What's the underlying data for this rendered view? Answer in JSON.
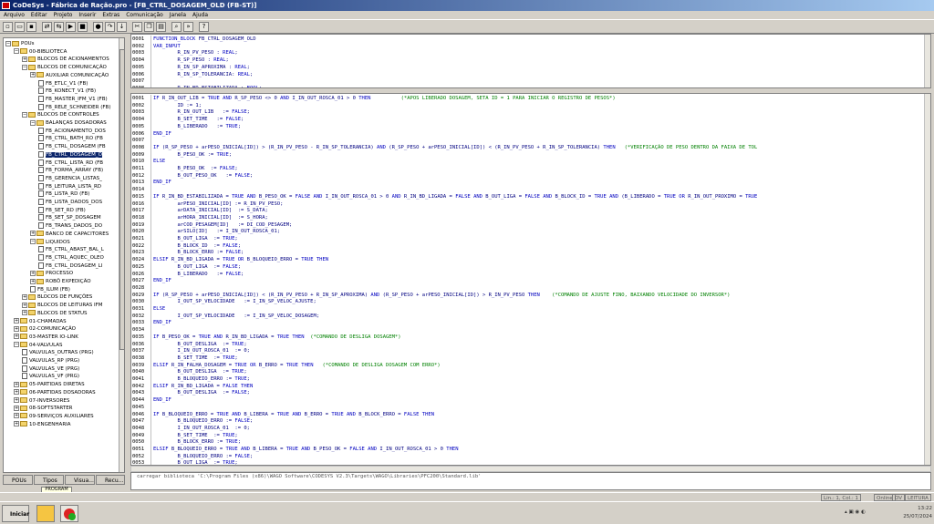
{
  "window": {
    "title": "CoDeSys - Fábrica de Ração.pro - [FB_CTRL_DOSAGEM_OLD (FB-ST)]"
  },
  "menu": [
    "Arquivo",
    "Editar",
    "Projeto",
    "Inserir",
    "Extras",
    "Comunicação",
    "Janela",
    "Ajuda"
  ],
  "tree": [
    {
      "label": "POUs",
      "level": 0,
      "type": "folder",
      "expanded": true
    },
    {
      "label": "00-BIBLIOTECA",
      "level": 1,
      "type": "folder",
      "expanded": true
    },
    {
      "label": "BLOCOS DE ACIONAMENTOS",
      "level": 2,
      "type": "folder",
      "expanded": false
    },
    {
      "label": "BLOCOS DE COMUNICAÇÃO",
      "level": 2,
      "type": "folder",
      "expanded": true
    },
    {
      "label": "AUXILIAR COMUNICAÇÃO",
      "level": 3,
      "type": "folder",
      "expanded": false
    },
    {
      "label": "FB_ETLC_V1 (FB)",
      "level": 4,
      "type": "doc"
    },
    {
      "label": "FB_KONECT_V1 (FB)",
      "level": 4,
      "type": "doc"
    },
    {
      "label": "FB_MASTER_IFM_V1 (FB)",
      "level": 4,
      "type": "doc"
    },
    {
      "label": "FB_RELE_SCHNEIDER (FB)",
      "level": 4,
      "type": "doc"
    },
    {
      "label": "BLOCOS DE CONTROLES",
      "level": 2,
      "type": "folder",
      "expanded": true
    },
    {
      "label": "BALANÇAS DOSADORAS",
      "level": 3,
      "type": "folder",
      "expanded": true
    },
    {
      "label": "FB_ACIONAMENTO_DOS",
      "level": 4,
      "type": "doc"
    },
    {
      "label": "FB_CTRL_BATH_RO (FB",
      "level": 4,
      "type": "doc"
    },
    {
      "label": "FB_CTRL_DOSAGEM (FB",
      "level": 4,
      "type": "doc"
    },
    {
      "label": "FB_CTRL_DOSAGEM_O",
      "level": 4,
      "type": "doc",
      "selected": true
    },
    {
      "label": "FB_CTRL_LISTA_RD (FB",
      "level": 4,
      "type": "doc"
    },
    {
      "label": "FB_FORMA_ARRAY (FB)",
      "level": 4,
      "type": "doc"
    },
    {
      "label": "FB_GERENCIA_LISTAS_",
      "level": 4,
      "type": "doc"
    },
    {
      "label": "FB_LEITURA_LISTA_RD",
      "level": 4,
      "type": "doc"
    },
    {
      "label": "FB_LISTA_RD (FB)",
      "level": 4,
      "type": "doc"
    },
    {
      "label": "FB_LISTA_DADOS_DOS",
      "level": 4,
      "type": "doc"
    },
    {
      "label": "FB_SET_RD (FB)",
      "level": 4,
      "type": "doc"
    },
    {
      "label": "FB_SET_SP_DOSAGEM",
      "level": 4,
      "type": "doc"
    },
    {
      "label": "FB_TRANS_DADOS_DO",
      "level": 4,
      "type": "doc"
    },
    {
      "label": "BANCO DE CAPACITORES",
      "level": 3,
      "type": "folder",
      "expanded": false
    },
    {
      "label": "LIQUIDOS",
      "level": 3,
      "type": "folder",
      "expanded": true
    },
    {
      "label": "FB_CTRL_ABAST_BAL_L",
      "level": 4,
      "type": "doc"
    },
    {
      "label": "FB_CTRL_AQUEC_OLEO",
      "level": 4,
      "type": "doc"
    },
    {
      "label": "FB_CTRL_DOSAGEM_LI",
      "level": 4,
      "type": "doc"
    },
    {
      "label": "PROCESSO",
      "level": 3,
      "type": "folder",
      "expanded": false
    },
    {
      "label": "ROBÔ EXPEDIÇÃO",
      "level": 3,
      "type": "folder",
      "expanded": false
    },
    {
      "label": "FB_ILUM (FB)",
      "level": 3,
      "type": "doc"
    },
    {
      "label": "BLOCOS DE FUNÇÕES",
      "level": 2,
      "type": "folder",
      "expanded": false
    },
    {
      "label": "BLOCOS DE LEITURAS IFM",
      "level": 2,
      "type": "folder",
      "expanded": false
    },
    {
      "label": "BLOCOS DE STATUS",
      "level": 2,
      "type": "folder",
      "expanded": false
    },
    {
      "label": "01-CHAMADAS",
      "level": 1,
      "type": "folder",
      "expanded": false
    },
    {
      "label": "02-COMUNICAÇÃO",
      "level": 1,
      "type": "folder",
      "expanded": false
    },
    {
      "label": "03-MASTER IO-LINK",
      "level": 1,
      "type": "folder",
      "expanded": false
    },
    {
      "label": "04-VALVULAS",
      "level": 1,
      "type": "folder",
      "expanded": true
    },
    {
      "label": "VALVULAS_OUTRAS (PRG)",
      "level": 2,
      "type": "doc"
    },
    {
      "label": "VALVULAS_RP (PRG)",
      "level": 2,
      "type": "doc"
    },
    {
      "label": "VALVULAS_VE (PRG)",
      "level": 2,
      "type": "doc"
    },
    {
      "label": "VALVULAS_VF (PRG)",
      "level": 2,
      "type": "doc"
    },
    {
      "label": "05-PARTIDAS DIRETAS",
      "level": 1,
      "type": "folder",
      "expanded": false
    },
    {
      "label": "06-PARTIDAS DOSADORAS",
      "level": 1,
      "type": "folder",
      "expanded": false
    },
    {
      "label": "07-INVERSORES",
      "level": 1,
      "type": "folder",
      "expanded": false
    },
    {
      "label": "08-SOFTSTARTER",
      "level": 1,
      "type": "folder",
      "expanded": false
    },
    {
      "label": "09-SERVIÇOS AUXILIARES",
      "level": 1,
      "type": "folder",
      "expanded": false
    },
    {
      "label": "10-ENGENHARIA",
      "level": 1,
      "type": "folder",
      "expanded": false
    }
  ],
  "left_tabs": [
    "POUs",
    "Tipos",
    "Visua...",
    "Recu..."
  ],
  "tab_tooltip": "PROGRAM",
  "declaration_lines": [
    {
      "n": "0001",
      "t": "FUNCTION_BLOCK FB_CTRL_DOSAGEM_OLD"
    },
    {
      "n": "0002",
      "t": "VAR_INPUT"
    },
    {
      "n": "0003",
      "t": "        R_IN_PV_PESO : REAL;"
    },
    {
      "n": "0004",
      "t": "        R_SP_PESO : REAL;"
    },
    {
      "n": "0005",
      "t": "        R_IN_SP_APROXIMA : REAL;"
    },
    {
      "n": "0006",
      "t": "        R_IN_SP_TOLERANCIA: REAL;"
    },
    {
      "n": "0007",
      "t": ""
    },
    {
      "n": "0008",
      "t": "        R_IN_BD_ESTABILIZADA : BOOL;"
    }
  ],
  "code_lines": [
    {
      "n": "0001",
      "t": "IF R_IN_OUT_LIB = TRUE AND R_SP_PESO <> 0 AND I_IN_OUT_ROSCA_01 > 0 THEN          (*APOS LIBERADO DOSAGEM, SETA ID = 1 PARA INICIAR O REGISTRO DE PESOS*)"
    },
    {
      "n": "0002",
      "t": "        ID := 1;"
    },
    {
      "n": "0003",
      "t": "        R_IN_OUT_LIB   := FALSE;"
    },
    {
      "n": "0004",
      "t": "        B_SET_TIME   := FALSE;"
    },
    {
      "n": "0005",
      "t": "        B_LIBERADO   := TRUE;"
    },
    {
      "n": "0006",
      "t": "END_IF"
    },
    {
      "n": "0007",
      "t": ""
    },
    {
      "n": "0008",
      "t": "IF (R_SP_PESO + arPESO_INICIAL[ID]) > (R_IN_PV_PESO - R_IN_SP_TOLERANCIA) AND (R_SP_PESO + arPESO_INICIAL[ID]) < (R_IN_PV_PESO + R_IN_SP_TOLERANCIA) THEN   (*VERIFICAÇÃO DE PESO DENTRO DA FAIXA DE TOL"
    },
    {
      "n": "0009",
      "t": "        B_PESO_OK := TRUE;"
    },
    {
      "n": "0010",
      "t": "ELSE"
    },
    {
      "n": "0011",
      "t": "        B_PESO_OK  := FALSE;"
    },
    {
      "n": "0012",
      "t": "        B_OUT_PESO_OK   := FALSE;"
    },
    {
      "n": "0013",
      "t": "END_IF"
    },
    {
      "n": "0014",
      "t": ""
    },
    {
      "n": "0015",
      "t": "IF R_IN_BD_ESTABILIZADA = TRUE AND B_PESO_OK = FALSE AND I_IN_OUT_ROSCA_01 > 0 AND R_IN_BD_LIGADA = FALSE AND B_OUT_LIGA = FALSE AND B_BLOCK_ID = TRUE AND (B_LIBERADO = TRUE OR R_IN_OUT_PROXIMO = TRUE"
    },
    {
      "n": "0016",
      "t": "        arPESO_INICIAL[ID] := R_IN_PV_PESO;"
    },
    {
      "n": "0017",
      "t": "        arDATA_INICIAL[ID]  := S_DATA;"
    },
    {
      "n": "0018",
      "t": "        arHORA_INICIAL[ID]  := S_HORA;"
    },
    {
      "n": "0019",
      "t": "        arCOD_PESAGEM[ID]   := DI_COD_PESAGEM;"
    },
    {
      "n": "0020",
      "t": "        arSILO[ID]   := I_IN_OUT_ROSCA_01;"
    },
    {
      "n": "0021",
      "t": "        B_OUT_LIGA  := TRUE;"
    },
    {
      "n": "0022",
      "t": "        B_BLOCK_ID  := FALSE;"
    },
    {
      "n": "0023",
      "t": "        B_BLOCK_ERRO := FALSE;"
    },
    {
      "n": "0024",
      "t": "ELSIF R_IN_BD_LIGADA = TRUE OR B_BLOQUEIO_ERRO = TRUE THEN"
    },
    {
      "n": "0025",
      "t": "        B_OUT_LIGA  := FALSE;"
    },
    {
      "n": "0026",
      "t": "        B_LIBERADO   := FALSE;"
    },
    {
      "n": "0027",
      "t": "END_IF"
    },
    {
      "n": "0028",
      "t": ""
    },
    {
      "n": "0029",
      "t": "IF (R_SP_PESO + arPESO_INICIAL[ID]) < (R_IN_PV_PESO + R_IN_SP_APROXIMA) AND (R_SP_PESO + arPESO_INICIAL[ID]) > R_IN_PV_PESO THEN    (*COMANDO DE AJUSTE FINO, BAIXANDO VELOCIDADE DO INVERSOR*)"
    },
    {
      "n": "0030",
      "t": "        I_OUT_SP_VELOCIDADE   := I_IN_SP_VELOC_AJUSTE;"
    },
    {
      "n": "0031",
      "t": "ELSE"
    },
    {
      "n": "0032",
      "t": "        I_OUT_SP_VELOCIDADE   := I_IN_SP_VELOC_DOSAGEM;"
    },
    {
      "n": "0033",
      "t": "END_IF"
    },
    {
      "n": "0034",
      "t": ""
    },
    {
      "n": "0035",
      "t": "IF B_PESO_OK = TRUE AND R_IN_BD_LIGADA = TRUE THEN  (*COMANDO DE DESLIGA DOSAGEM*)"
    },
    {
      "n": "0036",
      "t": "        B_OUT_DESLIGA  := TRUE;"
    },
    {
      "n": "0037",
      "t": "        I_IN_OUT_ROSCA_01  := 0;"
    },
    {
      "n": "0038",
      "t": "        B_SET_TIME  := TRUE;"
    },
    {
      "n": "0039",
      "t": "ELSIF R_IN_FALHA_DOSAGEM = TRUE OR B_ERRO = TRUE THEN   (*COMANDO DE DESLIGA DOSAGEM COM ERRO*)"
    },
    {
      "n": "0040",
      "t": "        B_OUT_DESLIGA  := TRUE;"
    },
    {
      "n": "0041",
      "t": "        B_BLOQUEIO_ERRO := TRUE;"
    },
    {
      "n": "0042",
      "t": "ELSIF R_IN_BD_LIGADA = FALSE THEN"
    },
    {
      "n": "0043",
      "t": "        B_OUT_DESLIGA  := FALSE;"
    },
    {
      "n": "0044",
      "t": "END_IF"
    },
    {
      "n": "0045",
      "t": ""
    },
    {
      "n": "0046",
      "t": "IF B_BLOQUEIO_ERRO = TRUE AND B_LIBERA = TRUE AND B_ERRO = TRUE AND B_BLOCK_ERRO = FALSE THEN"
    },
    {
      "n": "0047",
      "t": "        B_BLOQUEIO_ERRO := FALSE;"
    },
    {
      "n": "0048",
      "t": "        I_IN_OUT_ROSCA_01  := 0;"
    },
    {
      "n": "0049",
      "t": "        B_SET_TIME  := TRUE;"
    },
    {
      "n": "0050",
      "t": "        B_BLOCK_ERRO := TRUE;"
    },
    {
      "n": "0051",
      "t": "ELSIF B_BLOQUEIO_ERRO = TRUE AND B_LIBERA = TRUE AND B_PESO_OK = FALSE AND I_IN_OUT_ROSCA_01 > 0 THEN"
    },
    {
      "n": "0052",
      "t": "        B_BLOQUEIO_ERRO := FALSE;"
    },
    {
      "n": "0053",
      "t": "        B_OUT_LIGA  := TRUE;"
    }
  ],
  "message": "carregar biblioteca 'C:\\Program Files (x86)\\WAGO Software\\CODESYS V2.3\\Targets\\WAGO\\Libraries\\PFC200\\Standard.lib'",
  "status": {
    "position": "Lin.: 1, Col.: 1",
    "online": "Online",
    "ov": "OV",
    "leitura": "LEITURA"
  },
  "taskbar": {
    "start": "Iniciar",
    "time": "13:22",
    "date": "25/07/2024"
  },
  "colors": {
    "keyword": "#0000c0",
    "identifier": "#000080",
    "comment": "#008000",
    "selected": "#0a246a"
  }
}
